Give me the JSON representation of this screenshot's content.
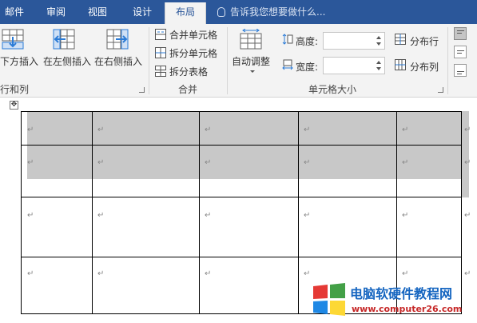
{
  "tabs": [
    {
      "label": "邮件"
    },
    {
      "label": "审阅"
    },
    {
      "label": "视图"
    },
    {
      "label": "设计"
    },
    {
      "label": "布局"
    }
  ],
  "tell_me": "告诉我您想要做什么...",
  "ribbon": {
    "rows_cols": {
      "insert_below": "下方插入",
      "insert_left": "在左侧插入",
      "insert_right": "在右侧插入",
      "label": "行和列"
    },
    "merge": {
      "merge_cells": "合并单元格",
      "split_cells": "拆分单元格",
      "split_table": "拆分表格",
      "label": "合并"
    },
    "cell_size": {
      "autofit": "自动调整",
      "height_label": "高度:",
      "width_label": "宽度:",
      "height_value": "",
      "width_value": "",
      "distribute_rows": "分布行",
      "distribute_cols": "分布列",
      "label": "单元格大小"
    }
  },
  "table": {
    "cell_mark": "↵",
    "move_handle": "✥"
  },
  "watermark": {
    "site_name": "电脑软硬件教程网",
    "url": "www.computer26.com"
  },
  "colors": {
    "tab_bar": "#2b579a",
    "ribbon_bg": "#f3f3f3",
    "selection": "#c8c8c8",
    "accent_blue": "#1565c0"
  }
}
